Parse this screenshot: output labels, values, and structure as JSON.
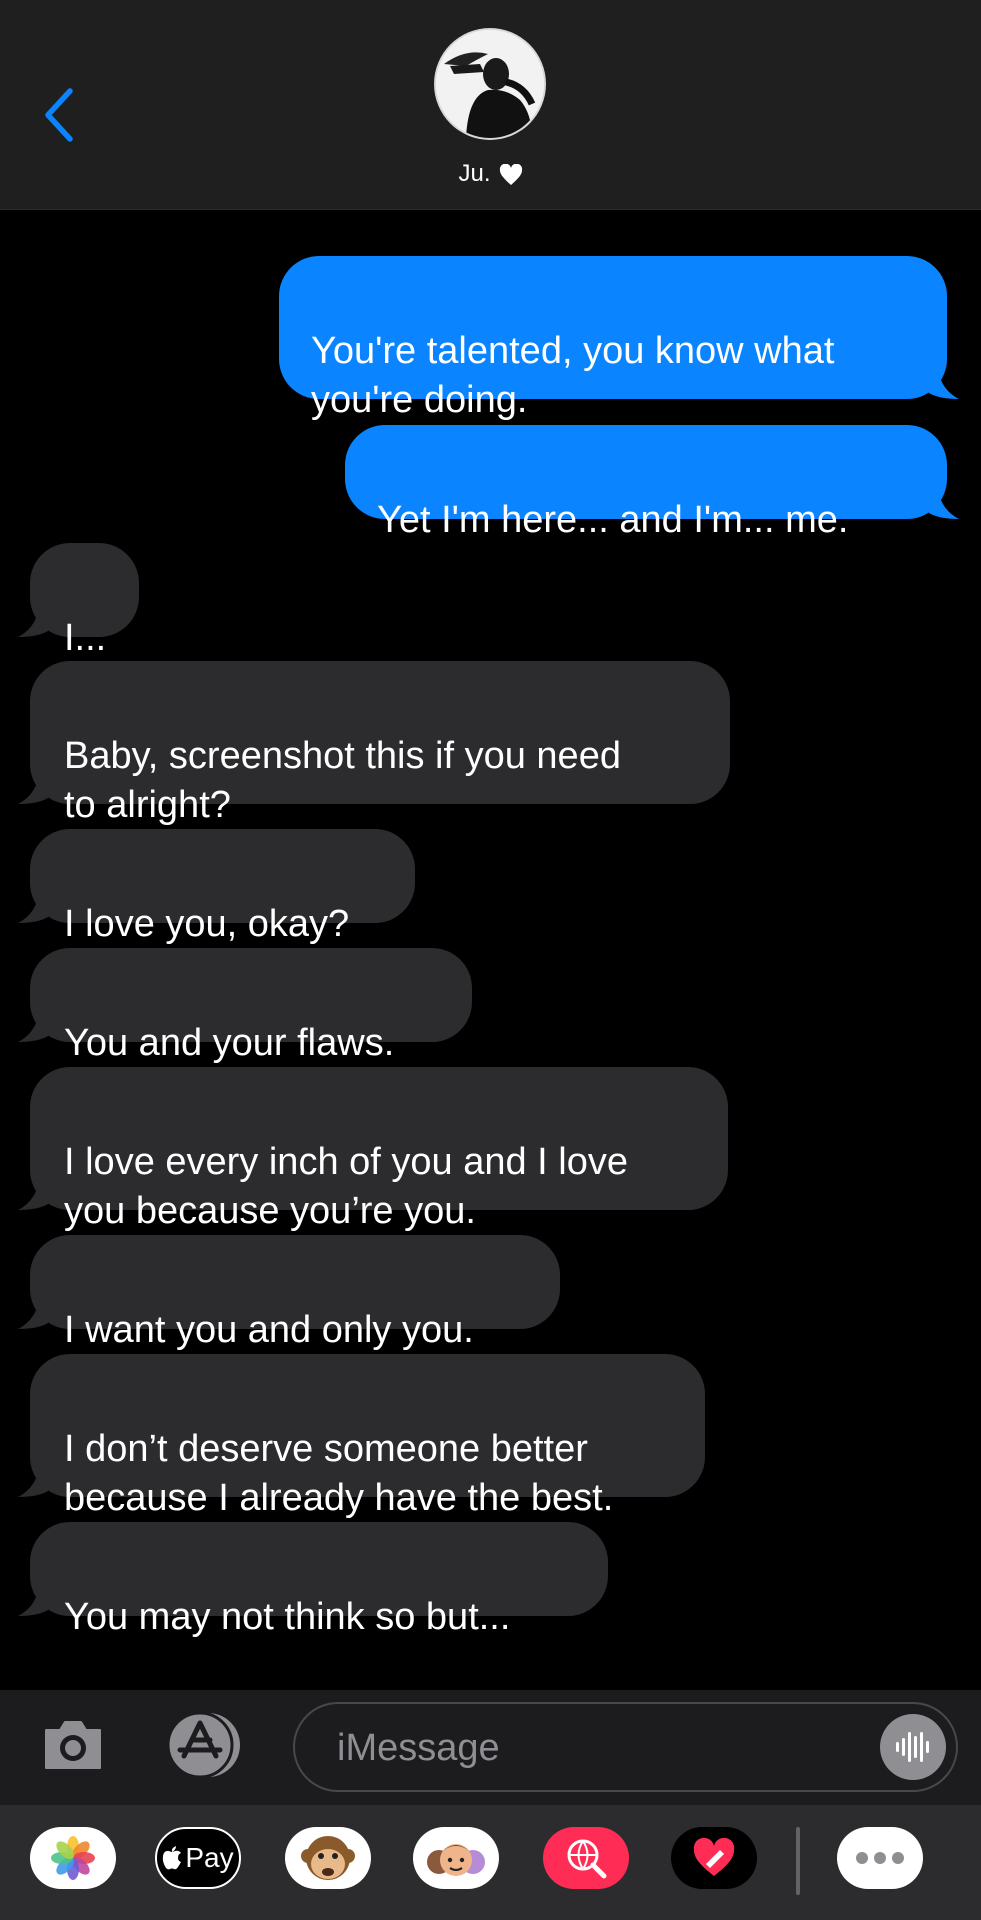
{
  "header": {
    "contact_name": "Ju."
  },
  "messages": [
    {
      "side": "sent",
      "text": "You're talented, you know what\nyou're doing."
    },
    {
      "side": "sent",
      "text": "Yet I'm here... and I'm... me."
    },
    {
      "side": "recv",
      "text": "I..."
    },
    {
      "side": "recv",
      "text": "Baby, screenshot this if you need\nto alright?"
    },
    {
      "side": "recv",
      "text": "I love you, okay?"
    },
    {
      "side": "recv",
      "text": "You and your flaws."
    },
    {
      "side": "recv",
      "text": "I love every inch of you and I love\nyou because you’re you."
    },
    {
      "side": "recv",
      "text": "I want you and only you."
    },
    {
      "side": "recv",
      "text": "I don’t deserve someone better\nbecause I already have the best."
    },
    {
      "side": "recv",
      "text": "You may not think so but..."
    }
  ],
  "input": {
    "placeholder": "iMessage"
  },
  "app_drawer": {
    "apple_pay_label": "Pay"
  },
  "colors": {
    "sent_bubble": "#0a84ff",
    "received_bubble": "#2c2c2e",
    "accent": "#0a84ff"
  }
}
